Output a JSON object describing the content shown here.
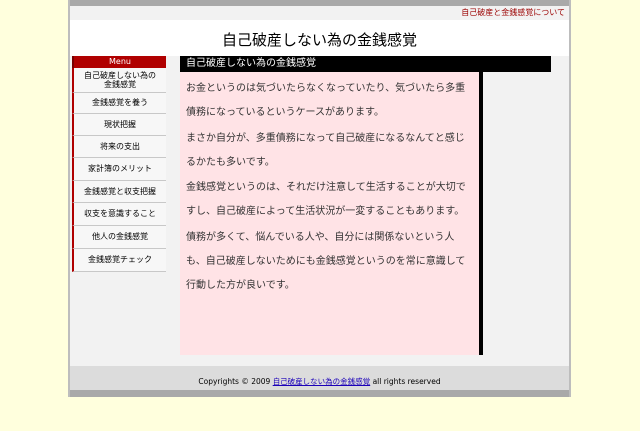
{
  "header": {
    "link": "自己破産と金銭感覚について",
    "title": "自己破産しない為の金銭感覚"
  },
  "menu": {
    "title": "Menu",
    "items": [
      {
        "label": "自己破産しない為の\n金銭感覚"
      },
      {
        "label": "金銭感覚を養う"
      },
      {
        "label": "現状把握"
      },
      {
        "label": "将来の支出"
      },
      {
        "label": "家計簿のメリット"
      },
      {
        "label": "金銭感覚と収支把握"
      },
      {
        "label": "収支を意識すること"
      },
      {
        "label": "他人の金銭感覚"
      },
      {
        "label": "金銭感覚チェック"
      }
    ]
  },
  "content": {
    "title": "自己破産しない為の金銭感覚",
    "paragraphs": [
      "お金というのは気づいたらなくなっていたり、気づいたら多重債務になっているというケースがあります。",
      "まさか自分が、多重債務になって自己破産になるなんてと感じるかたも多いです。",
      "金銭感覚というのは、それだけ注意して生活することが大切ですし、自己破産によって生活状況が一変することもあります。",
      "債務が多くて、悩んでいる人や、自分には関係ないという人も、自己破産しないためにも金銭感覚というのを常に意識して行動した方が良いです。"
    ]
  },
  "footer": {
    "prefix": "Copyrights © 2009 ",
    "link": "自己破産しない為の金銭感覚",
    "suffix": " all rights reserved"
  },
  "colors": {
    "background": "#ffffdd",
    "accent": "#b00000",
    "content_bg": "#ffe3e6"
  }
}
